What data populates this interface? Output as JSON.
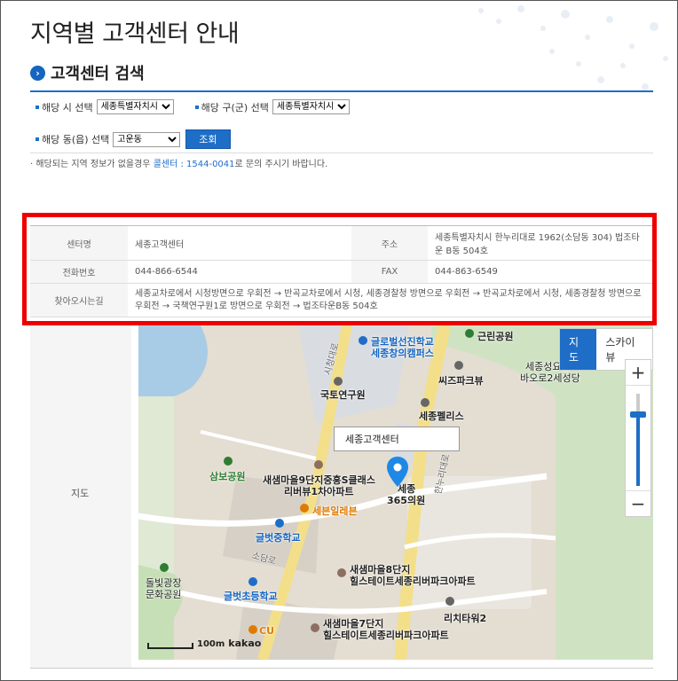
{
  "page": {
    "title": "지역별 고객센터 안내"
  },
  "search": {
    "section_title": "고객센터 검색",
    "city_label": "해당 시 선택",
    "city_value": "세종특별자치시",
    "district_label": "해당 구(군) 선택",
    "district_value": "세종특별자치시",
    "dong_label": "해당 동(읍) 선택",
    "dong_value": "고운동",
    "submit_label": "조회"
  },
  "notice": {
    "prefix": "· 해당되는 지역 정보가 없을경우 ",
    "callcenter": "콜센터 : 1544-0041",
    "suffix": "로 문의 주시기 바랍니다."
  },
  "info": {
    "name_label": "센터명",
    "name_value": "세종고객센터",
    "address_label": "주소",
    "address_value": "세종특별자치시 한누리대로 1962(소담동 304) 법조타운 B동 504호",
    "phone_label": "전화번호",
    "phone_value": "044-866-6544",
    "fax_label": "FAX",
    "fax_value": "044-863-6549",
    "directions_label": "찾아오시는길",
    "directions_value": "세종교차로에서 시청방면으로 우회전 → 반곡교차로에서 시청, 세종경찰청 방면으로 우회전 → 반곡교차로에서 시청, 세종경찰청 방면으로 우회전 → 국책연구원1로 방면으로 우회전 → 법조타운B동 504호",
    "map_label": "지도"
  },
  "map": {
    "callout": "세종고객센터",
    "type_map": "지도",
    "type_sky": "스카이뷰",
    "zoom_in": "+",
    "zoom_out": "−",
    "scale": "100m",
    "brand": "kakao",
    "labels": {
      "l1": "글로벌선진학교",
      "l2": "세종창의캠퍼스",
      "l3": "근린공원",
      "l4": "세종성요한",
      "l5": "바오로2세성당",
      "l6": "씨즈파크뷰",
      "l7": "국토연구원",
      "l8": "세종펠리스",
      "l9": "삼보공원",
      "l10": "새샘마을9단지중흥S클래스",
      "l11": "리버뷰1차아파트",
      "l12": "세종",
      "l13": "365의원",
      "l14": "세븐일레븐",
      "l15": "글벗중학교",
      "l16": "돌빛광장",
      "l17": "문화공원",
      "l18": "글벗초등학교",
      "l19": "새샘마을8단지",
      "l20": "힐스테이트세종리버파크아파트",
      "l21": "리치타워2",
      "l22": "새샘마을7단지",
      "l23": "힐스테이트세종리버파크아파트",
      "l24": "CU",
      "l25": "한누리대로",
      "l26": "시청대로",
      "l27": "소담로"
    }
  },
  "colors": {
    "accent": "#1e6ec8",
    "highlight": "#ee0000"
  }
}
